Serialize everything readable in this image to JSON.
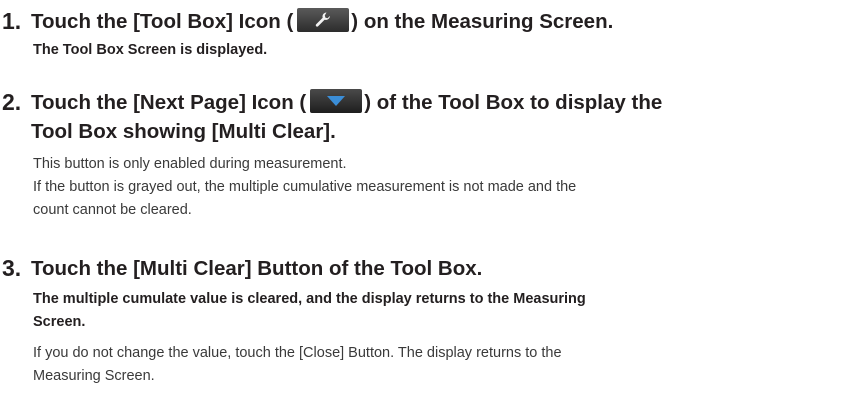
{
  "steps": [
    {
      "number": "1.",
      "heading_before": "Touch the [Tool Box] Icon (",
      "icon": "wrench-icon",
      "heading_after": ") on the Measuring Screen.",
      "result": "The Tool Box Screen is displayed."
    },
    {
      "number": "2.",
      "heading_before": "Touch the [Next Page] Icon (",
      "icon": "next-page-triangle-icon",
      "heading_after": ") of the Tool Box to display the",
      "heading_line2": "Tool Box showing [Multi Clear].",
      "note1": "This button is only enabled during measurement.",
      "note2_line1": "If the button is grayed out, the multiple cumulative measurement is not made and the",
      "note2_line2": "count cannot be cleared."
    },
    {
      "number": "3.",
      "heading": "Touch the [Multi Clear] Button of the Tool Box.",
      "result_line1": "The multiple cumulate value is cleared, and the display returns to the Measuring",
      "result_line2": "Screen.",
      "note_line1": "If you do not change the value, touch the [Close] Button. The display returns to the",
      "note_line2": "Measuring Screen."
    }
  ],
  "colors": {
    "text": "#231f20",
    "icon_bg": "#2c2c2c",
    "next_icon_fill": "#3b8ed8"
  }
}
